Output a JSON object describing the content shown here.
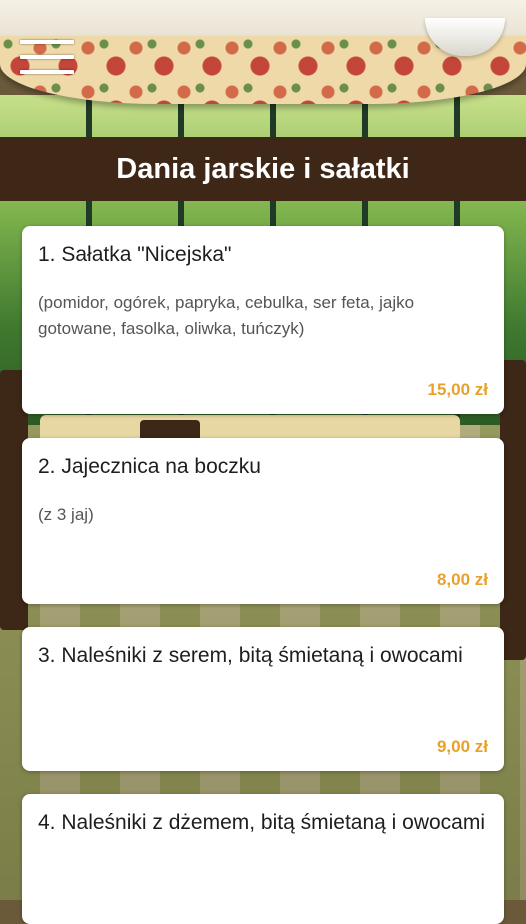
{
  "header": {
    "title": "Dania jarskie i sałatki",
    "menu_icon": "hamburger-menu-icon"
  },
  "items": [
    {
      "name": "1. Sałatka \"Nicejska\"",
      "description": "(pomidor, ogórek, papryka, cebulka, ser feta, jajko gotowane, fasolka, oliwka, tuńczyk)",
      "price": "15,00 zł"
    },
    {
      "name": "2. Jajecznica na boczku",
      "description": "(z 3 jaj)",
      "price": "8,00 zł"
    },
    {
      "name": "3. Naleśniki z serem, bitą śmietaną i owocami",
      "description": "",
      "price": "9,00 zł"
    },
    {
      "name": "4. Naleśniki z dżemem, bitą śmietaną i owocami",
      "description": "",
      "price": ""
    }
  ],
  "colors": {
    "title_bar": "#3e2716",
    "price": "#e8a22c",
    "card": "#ffffff"
  }
}
